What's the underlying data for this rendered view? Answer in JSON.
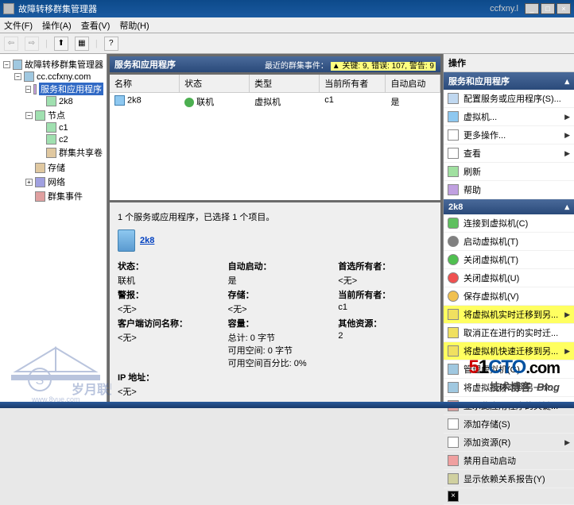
{
  "window": {
    "title": "故障转移群集管理器",
    "partial_text": "ccfxny.l"
  },
  "menu": {
    "file": "文件(F)",
    "action": "操作(A)",
    "view": "查看(V)",
    "help": "帮助(H)"
  },
  "tree": {
    "root": "故障转移群集管理器",
    "cluster": "cc.ccfxny.com",
    "services": "服务和应用程序",
    "vm": "2k8",
    "nodes": "节点",
    "node1": "c1",
    "node2": "c2",
    "csv": "群集共享卷",
    "storage": "存储",
    "network": "网络",
    "events": "群集事件"
  },
  "center": {
    "header_title": "服务和应用程序",
    "event_label": "最近的群集事件：",
    "event_warn": "▲ 关键: 9, 错误: 107, 警告: 9",
    "cols": {
      "name": "名称",
      "status": "状态",
      "type": "类型",
      "owner": "当前所有者",
      "auto": "自动启动"
    },
    "row": {
      "name": "2k8",
      "status": "联机",
      "type": "虚拟机",
      "owner": "c1",
      "auto": "是"
    }
  },
  "detail": {
    "summary": "1 个服务或应用程序，已选择 1 个项目。",
    "vm_name": "2k8",
    "labels": {
      "status": "状态：",
      "autostart": "自动启动：",
      "pref_owner": "首选所有者：",
      "alerts": "警报：",
      "storage": "存储：",
      "cur_owner": "当前所有者：",
      "cap": "客户端访问名称：",
      "capacity": "容量：",
      "other": "其他资源：",
      "ip": "IP 地址："
    },
    "vals": {
      "status": "联机",
      "autostart": "是",
      "pref_owner": "<无>",
      "alerts": "<无>",
      "storage": "<无>",
      "cur_owner": "c1",
      "cap": "<无>",
      "cap_total": "总计: 0 字节",
      "cap_free": "可用空间: 0 字节",
      "cap_pct": "可用空间百分比: 0%",
      "other": "2",
      "ip": "<无>"
    }
  },
  "actions": {
    "pane_title": "操作",
    "section1": "服务和应用程序",
    "s1": {
      "a1": "配置服务或应用程序(S)...",
      "a2": "虚拟机...",
      "a3": "更多操作...",
      "a4": "查看",
      "a5": "刷新",
      "a6": "帮助"
    },
    "section2": "2k8",
    "s2": {
      "b1": "连接到虚拟机(C)",
      "b2": "启动虚拟机(T)",
      "b3": "关闭虚拟机(T)",
      "b4": "关闭虚拟机(U)",
      "b5": "保存虚拟机(V)",
      "b6": "将虚拟机实时迁移到另...",
      "b7": "取消正在进行的实时迁...",
      "b8": "将虚拟机快速迁移到另...",
      "b9": "管理虚拟机(G)",
      "b10": "将虚拟机移动到另一个...",
      "b11": "显示此应用程序的关键...",
      "b12": "添加存储(S)",
      "b13": "添加资源(R)",
      "b14": "禁用自动启动",
      "b15": "显示依赖关系报告(Y)"
    }
  },
  "watermark": {
    "tech_blog": "技术博客",
    "blog": "Blog"
  }
}
